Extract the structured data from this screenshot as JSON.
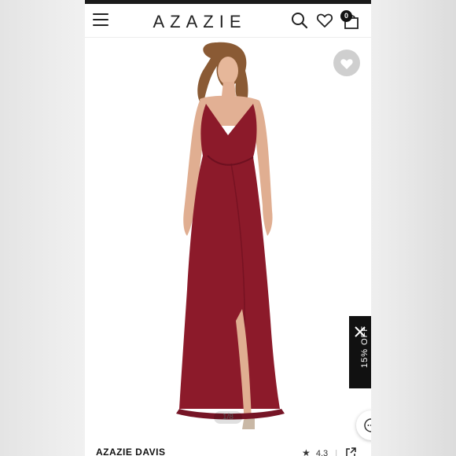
{
  "header": {
    "brand": "AZAZIE",
    "cart_count": "0"
  },
  "icons": {
    "menu": "hamburger-menu-icon",
    "search": "search-icon",
    "wishlist": "heart-icon",
    "cart": "shopping-bag-icon",
    "favorite": "heart-filled-icon",
    "close": "close-icon",
    "chat": "chat-bubble-icon",
    "share": "share-icon",
    "star": "star-icon"
  },
  "gallery": {
    "page_indicator": "1/8",
    "image_description_color": "#8c1a2a"
  },
  "promo": {
    "label": "15% OFF"
  },
  "product": {
    "title": "AZAZIE DAVIS",
    "rating": "4.3"
  },
  "colors": {
    "dress": "#8c1a2a",
    "topbar": "#1b1b1b",
    "promo_bg": "#111111",
    "fav_bg": "#cfcfcf"
  }
}
